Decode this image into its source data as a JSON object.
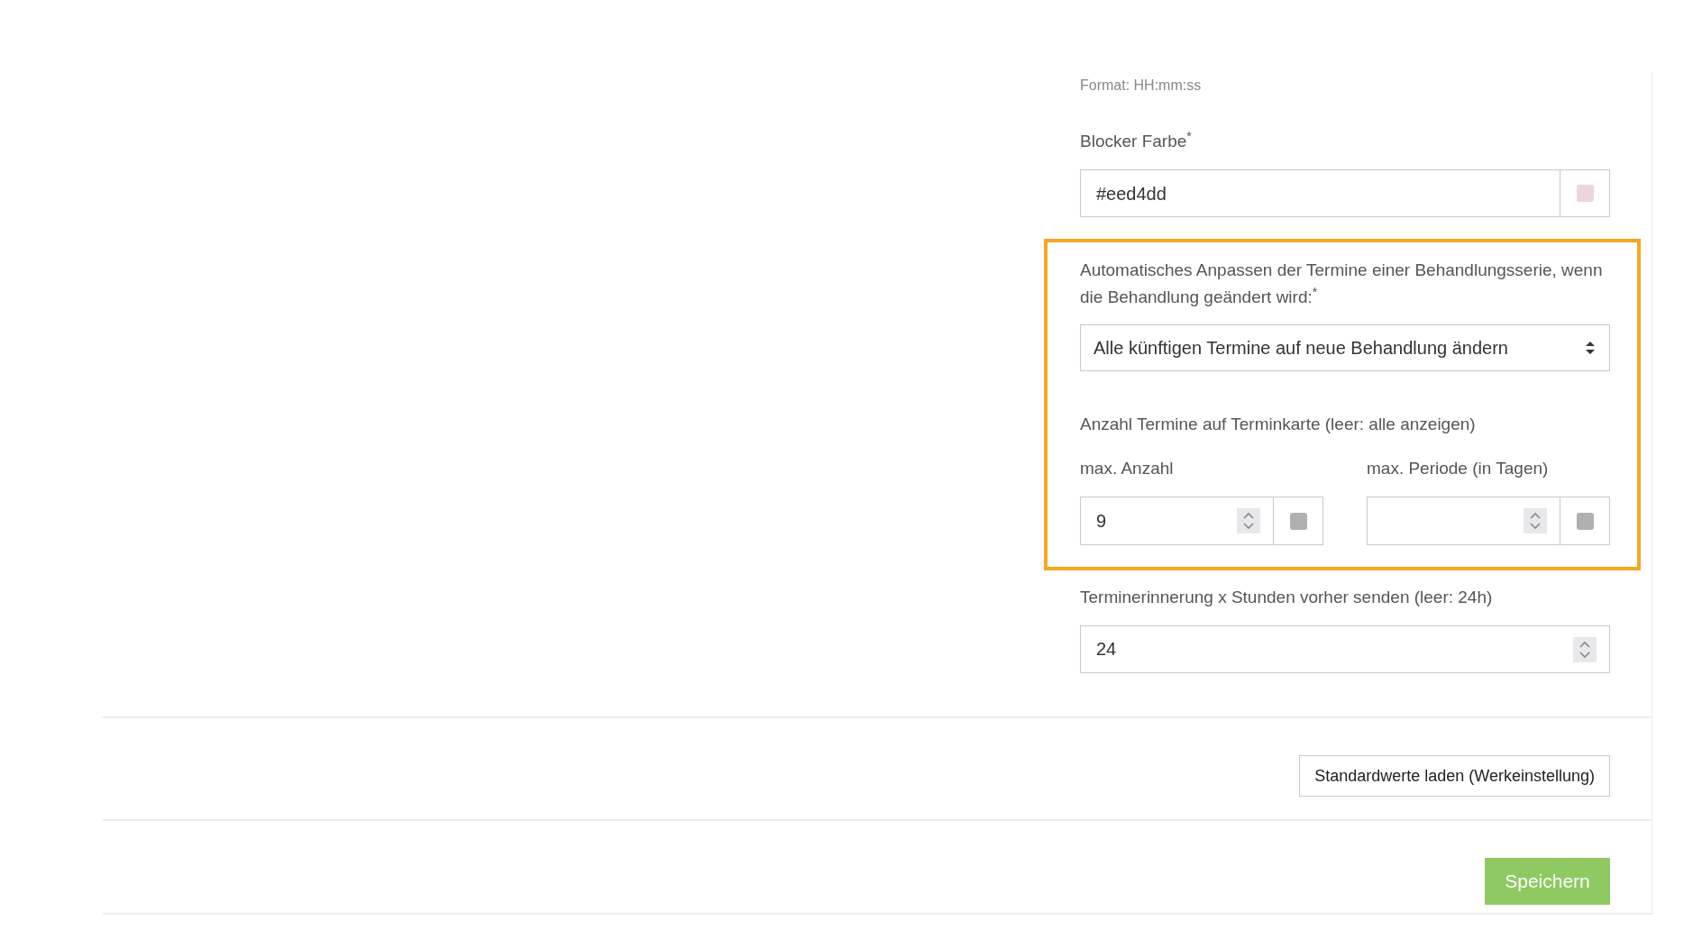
{
  "format_hint": "Format: HH:mm:ss",
  "blocker_color": {
    "label": "Blocker Farbe$^{*}$",
    "value": "#eed4dd"
  },
  "highlight": {
    "series_adjust": {
      "label": "Automatisches Anpassen der Termine einer Behandlungsserie, wenn die Behandlung geändert wird:$^{*}$",
      "value": "Alle künftigen Termine auf neue Behandlung ändern"
    },
    "appointment_card": {
      "title": "Anzahl Termine auf Terminkarte (leer: alle anzeigen)",
      "fields": [
        {
          "label": "max. Anzahl",
          "value": "9"
        },
        {
          "label": "max. Periode (in Tagen)"
        }
      ]
    }
  },
  "reminder": {
    "label": "Terminerinnerung x Stunden vorher senden (leer: 24h)",
    "value": "24"
  },
  "buttons": {
    "defaults": "Standardwerte laden (Werkeinstellung)",
    "save": "Speichern"
  }
}
